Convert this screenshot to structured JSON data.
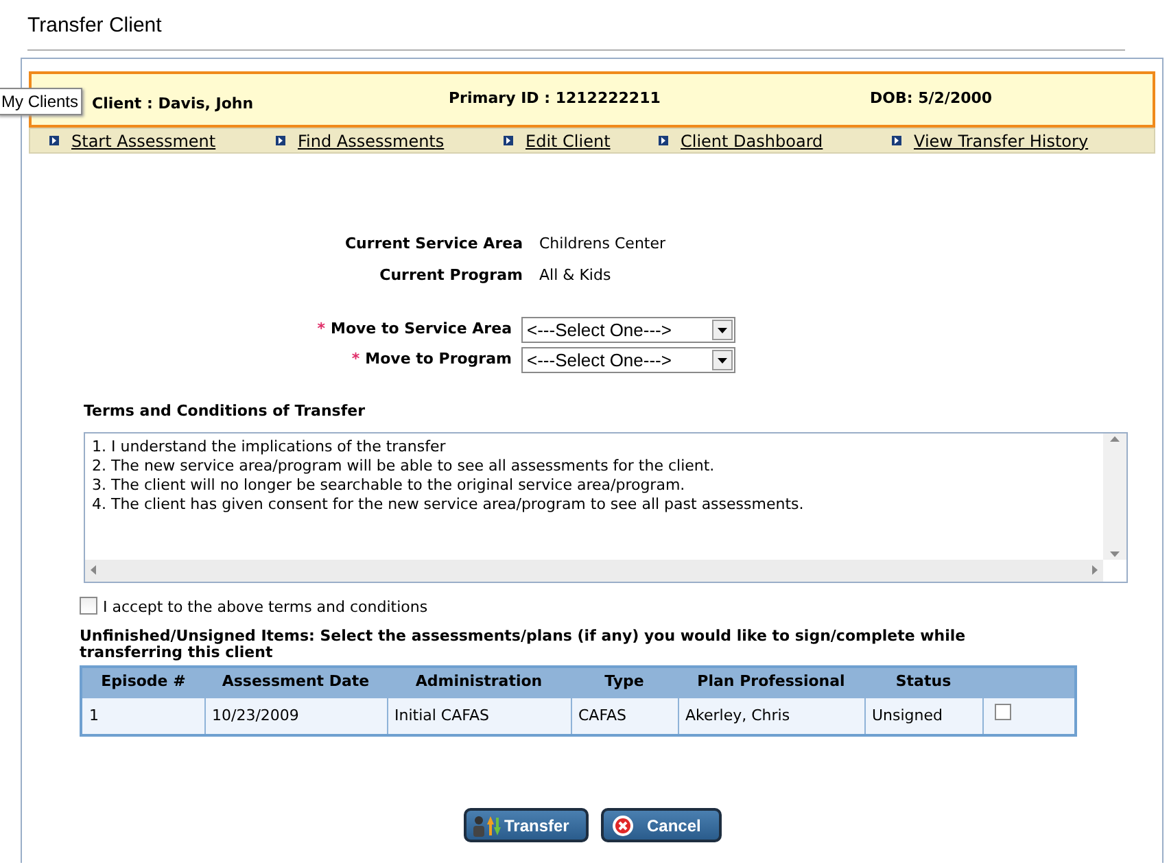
{
  "window": {
    "title": "Transfer Client"
  },
  "client_bar": {
    "client": "Client : Davis, John",
    "primary_id": "Primary ID : 1212222211",
    "dob": "DOB: 5/2/2000"
  },
  "tooltip": "My Clients",
  "nav_links": [
    "Start Assessment",
    "Find Assessments",
    "Edit Client",
    "Client Dashboard",
    "View Transfer History"
  ],
  "current": [
    {
      "label": "Current Service Area",
      "value": "Childrens Center"
    },
    {
      "label": "Current Program",
      "value": "All & Kids"
    }
  ],
  "move_fields": [
    {
      "required_mark": "*",
      "label": "Move to Service Area",
      "value": "<---Select One--->"
    },
    {
      "required_mark": "*",
      "label": "Move to Program",
      "value": "<---Select One--->"
    }
  ],
  "terms": {
    "heading": "Terms and Conditions of Transfer",
    "lines": [
      "1. I understand the implications of the transfer",
      "2. The new service area/program will be able to see all assessments for the client.",
      "3. The client will no longer be searchable to the original service area/program.",
      "4. The client has given consent for the new service area/program to see all past assessments."
    ],
    "accept_label": "I accept to the above terms and conditions",
    "accepted": false
  },
  "unfinished": {
    "heading": "Unfinished/Unsigned Items: Select the assessments/plans (if any) you would like to sign/complete while transferring this client",
    "columns": [
      "Episode #",
      "Assessment Date",
      "Administration",
      "Type",
      "Plan Professional",
      "Status"
    ],
    "rows": [
      {
        "cells": [
          "1",
          "10/23/2009",
          "Initial CAFAS",
          "CAFAS",
          "Akerley, Chris",
          "Unsigned"
        ],
        "checked": false
      }
    ]
  },
  "buttons": [
    {
      "kind": "transfer",
      "label": "Transfer"
    },
    {
      "kind": "cancel",
      "label": "Cancel"
    }
  ]
}
